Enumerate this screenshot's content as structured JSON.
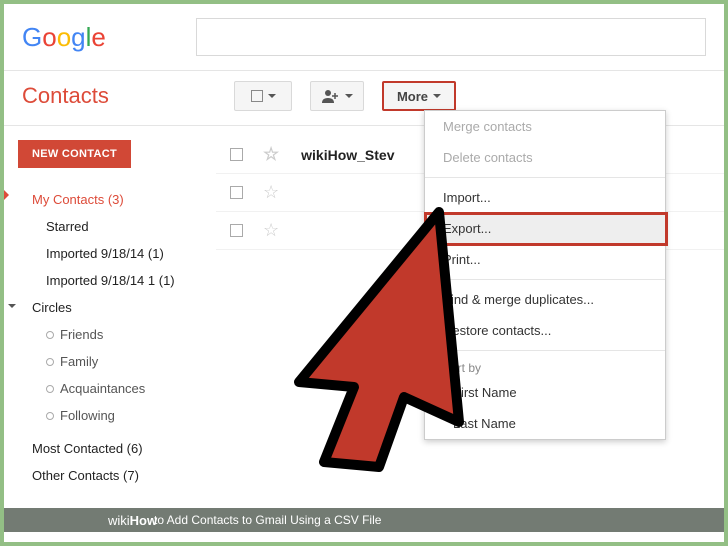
{
  "logo": [
    "G",
    "o",
    "o",
    "g",
    "l",
    "e"
  ],
  "app_title": "Contacts",
  "new_contact": "NEW CONTACT",
  "more_label": "More",
  "sidebar": {
    "my_contacts": "My Contacts (3)",
    "starred": "Starred",
    "imported1": "Imported 9/18/14 (1)",
    "imported2": "Imported 9/18/14 1 (1)",
    "circles": "Circles",
    "circle_items": [
      "Friends",
      "Family",
      "Acquaintances",
      "Following"
    ],
    "most_contacted": "Most Contacted (6)",
    "other_contacts": "Other Contacts (7)"
  },
  "rows": [
    "wikiHow_Stev",
    "",
    ""
  ],
  "dropdown": {
    "merge": "Merge contacts",
    "delete": "Delete contacts",
    "import": "Import...",
    "export": "Export...",
    "print": "Print...",
    "findmerge": "Find & merge duplicates...",
    "restore": "Restore contacts...",
    "sortby": "Sort by",
    "firstname": "First Name",
    "lastname": "Last Name"
  },
  "caption": {
    "brand": "wikiHow",
    "text": " to Add Contacts to Gmail Using a CSV File"
  }
}
